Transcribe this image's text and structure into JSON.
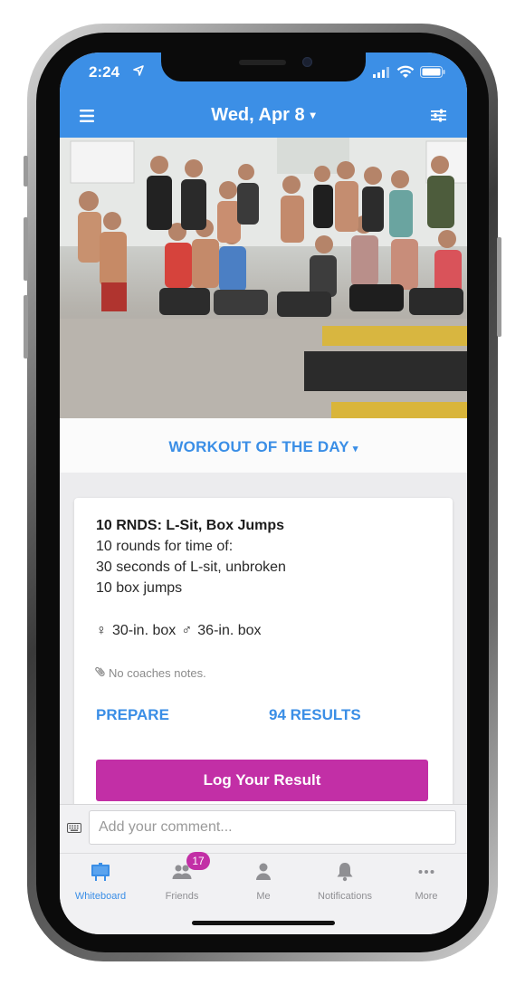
{
  "status_bar": {
    "time": "2:24"
  },
  "nav": {
    "title": "Wed, Apr 8",
    "title_caret": "▾"
  },
  "hero": {
    "alt": "Group photo of athletes in gym"
  },
  "section": {
    "title": "WORKOUT OF THE DAY",
    "caret": "▾"
  },
  "workout": {
    "title": "10 RNDS: L-Sit, Box Jumps",
    "lines": [
      "10 rounds for time of:",
      "30 seconds of L-sit, unbroken",
      "10 box jumps"
    ],
    "female_symbol": "♀",
    "female_scale": "30-in. box",
    "male_symbol": "♂",
    "male_scale": "36-in. box",
    "notes": "No coaches notes.",
    "prepare_label": "PREPARE",
    "results_label": "94 RESULTS",
    "log_button": "Log Your Result"
  },
  "comment": {
    "placeholder": "Add your comment..."
  },
  "tabs": [
    {
      "label": "Whiteboard",
      "icon": "whiteboard-icon",
      "active": true
    },
    {
      "label": "Friends",
      "icon": "friends-icon",
      "badge": "17"
    },
    {
      "label": "Me",
      "icon": "person-icon"
    },
    {
      "label": "Notifications",
      "icon": "bell-icon"
    },
    {
      "label": "More",
      "icon": "more-icon"
    }
  ],
  "colors": {
    "brand_blue": "#3c8fe6",
    "accent_magenta": "#c22fa6",
    "tab_inactive": "#8f8f93"
  }
}
